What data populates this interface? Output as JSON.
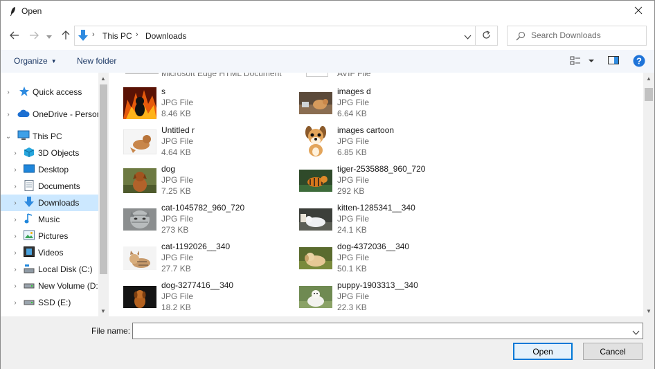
{
  "window": {
    "title": "Open"
  },
  "address": {
    "crumbs": [
      "This PC",
      "Downloads"
    ]
  },
  "search": {
    "placeholder": "Search Downloads"
  },
  "toolbar": {
    "organize": "Organize",
    "new_folder": "New folder"
  },
  "nav": {
    "items": [
      {
        "label": "Quick access",
        "icon": "star-icon"
      },
      {
        "label": "OneDrive - Person",
        "icon": "cloud-icon"
      },
      {
        "label": "This PC",
        "icon": "computer-icon"
      },
      {
        "label": "3D Objects",
        "icon": "cube-icon"
      },
      {
        "label": "Desktop",
        "icon": "desktop-icon"
      },
      {
        "label": "Documents",
        "icon": "document-icon"
      },
      {
        "label": "Downloads",
        "icon": "download-icon"
      },
      {
        "label": "Music",
        "icon": "music-icon"
      },
      {
        "label": "Pictures",
        "icon": "pictures-icon"
      },
      {
        "label": "Videos",
        "icon": "video-icon"
      },
      {
        "label": "Local Disk (C:)",
        "icon": "disk-icon"
      },
      {
        "label": "New Volume (D:",
        "icon": "drive-icon"
      },
      {
        "label": "SSD (E:)",
        "icon": "drive-icon"
      }
    ]
  },
  "partial_top": {
    "left": "Microsoft Edge HTML Document",
    "right": "AVIF File"
  },
  "files": [
    {
      "name": "s",
      "type": "JPG File",
      "size": "8.46 KB"
    },
    {
      "name": "images d",
      "type": "JPG File",
      "size": "6.64 KB"
    },
    {
      "name": "Untitled r",
      "type": "JPG File",
      "size": "4.64 KB"
    },
    {
      "name": "images cartoon",
      "type": "JPG File",
      "size": "6.85 KB"
    },
    {
      "name": "dog",
      "type": "JPG File",
      "size": "7.25 KB"
    },
    {
      "name": "tiger-2535888_960_720",
      "type": "JPG File",
      "size": "292 KB"
    },
    {
      "name": "cat-1045782_960_720",
      "type": "JPG File",
      "size": "273 KB"
    },
    {
      "name": "kitten-1285341__340",
      "type": "JPG File",
      "size": "24.1 KB"
    },
    {
      "name": "cat-1192026__340",
      "type": "JPG File",
      "size": "27.7 KB"
    },
    {
      "name": "dog-4372036__340",
      "type": "JPG File",
      "size": "50.1 KB"
    },
    {
      "name": "dog-3277416__340",
      "type": "JPG File",
      "size": "18.2 KB"
    },
    {
      "name": "puppy-1903313__340",
      "type": "JPG File",
      "size": "22.3 KB"
    }
  ],
  "bottom": {
    "file_name_label": "File name:",
    "file_name_value": "",
    "open": "Open",
    "cancel": "Cancel"
  },
  "colors": {
    "accent": "#0078d7",
    "selected": "#cce8ff",
    "help": "#1e73d8"
  }
}
